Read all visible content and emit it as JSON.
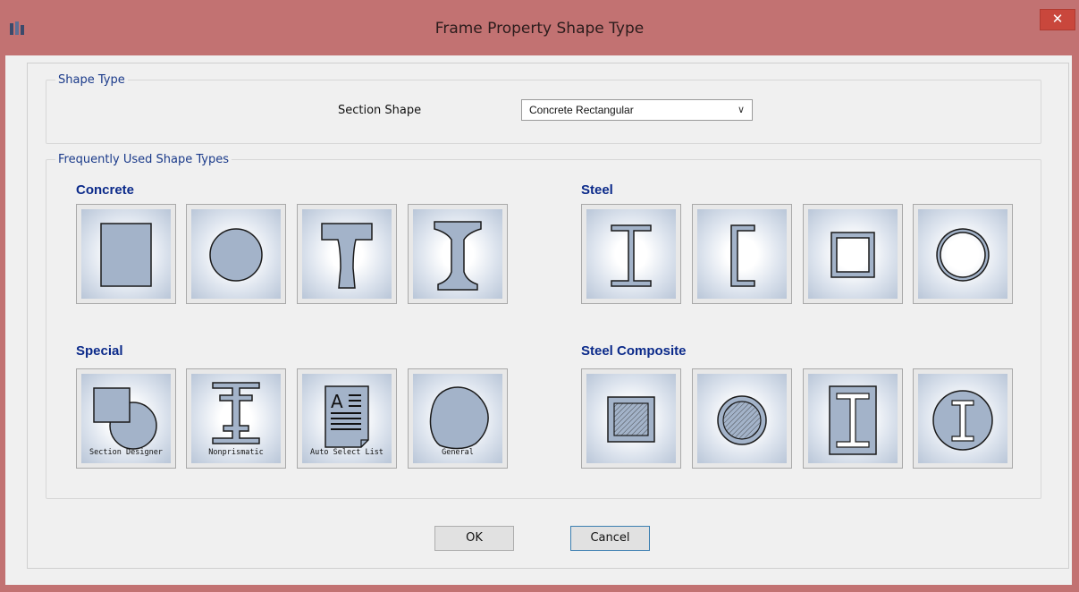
{
  "window": {
    "title": "Frame Property Shape Type",
    "close_glyph": "✕",
    "app_icon": "etabs-app-icon"
  },
  "shape_type": {
    "legend": "Shape Type",
    "section_shape_label": "Section Shape",
    "section_shape_value": "Concrete Rectangular"
  },
  "frequent": {
    "legend": "Frequently Used Shape Types",
    "concrete": {
      "label": "Concrete"
    },
    "steel": {
      "label": "Steel"
    },
    "special": {
      "label": "Special",
      "captions": [
        "Section Designer",
        "Nonprismatic",
        "Auto Select List",
        "General"
      ]
    },
    "steel_composite": {
      "label": "Steel Composite"
    }
  },
  "buttons": {
    "ok": "OK",
    "cancel": "Cancel"
  },
  "colors": {
    "fill": "#a3b3c9",
    "stroke": "#1a1a1a",
    "category": "#0b2a8a"
  }
}
